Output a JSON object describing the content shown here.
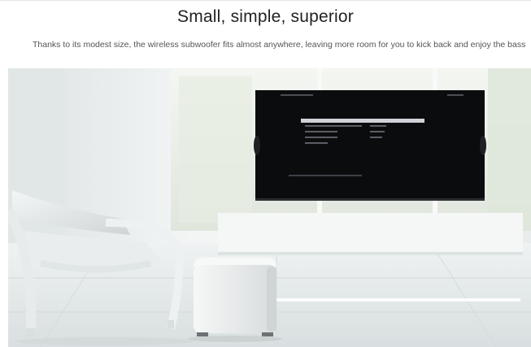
{
  "section": {
    "title": "Small, simple, superior",
    "subtitle": "Thanks to its modest size, the wireless subwoofer fits almost anywhere, leaving more room for you to kick back and enjoy the bass"
  },
  "colors": {
    "title_text": "#222222",
    "body_text": "#555555",
    "wall": "#eef1f1",
    "floor": "#e6ebeb",
    "tv_screen": "#0b0c0e",
    "subwoofer": "#ecefef"
  },
  "image": {
    "scene": "living-room-subwoofer-photo"
  }
}
